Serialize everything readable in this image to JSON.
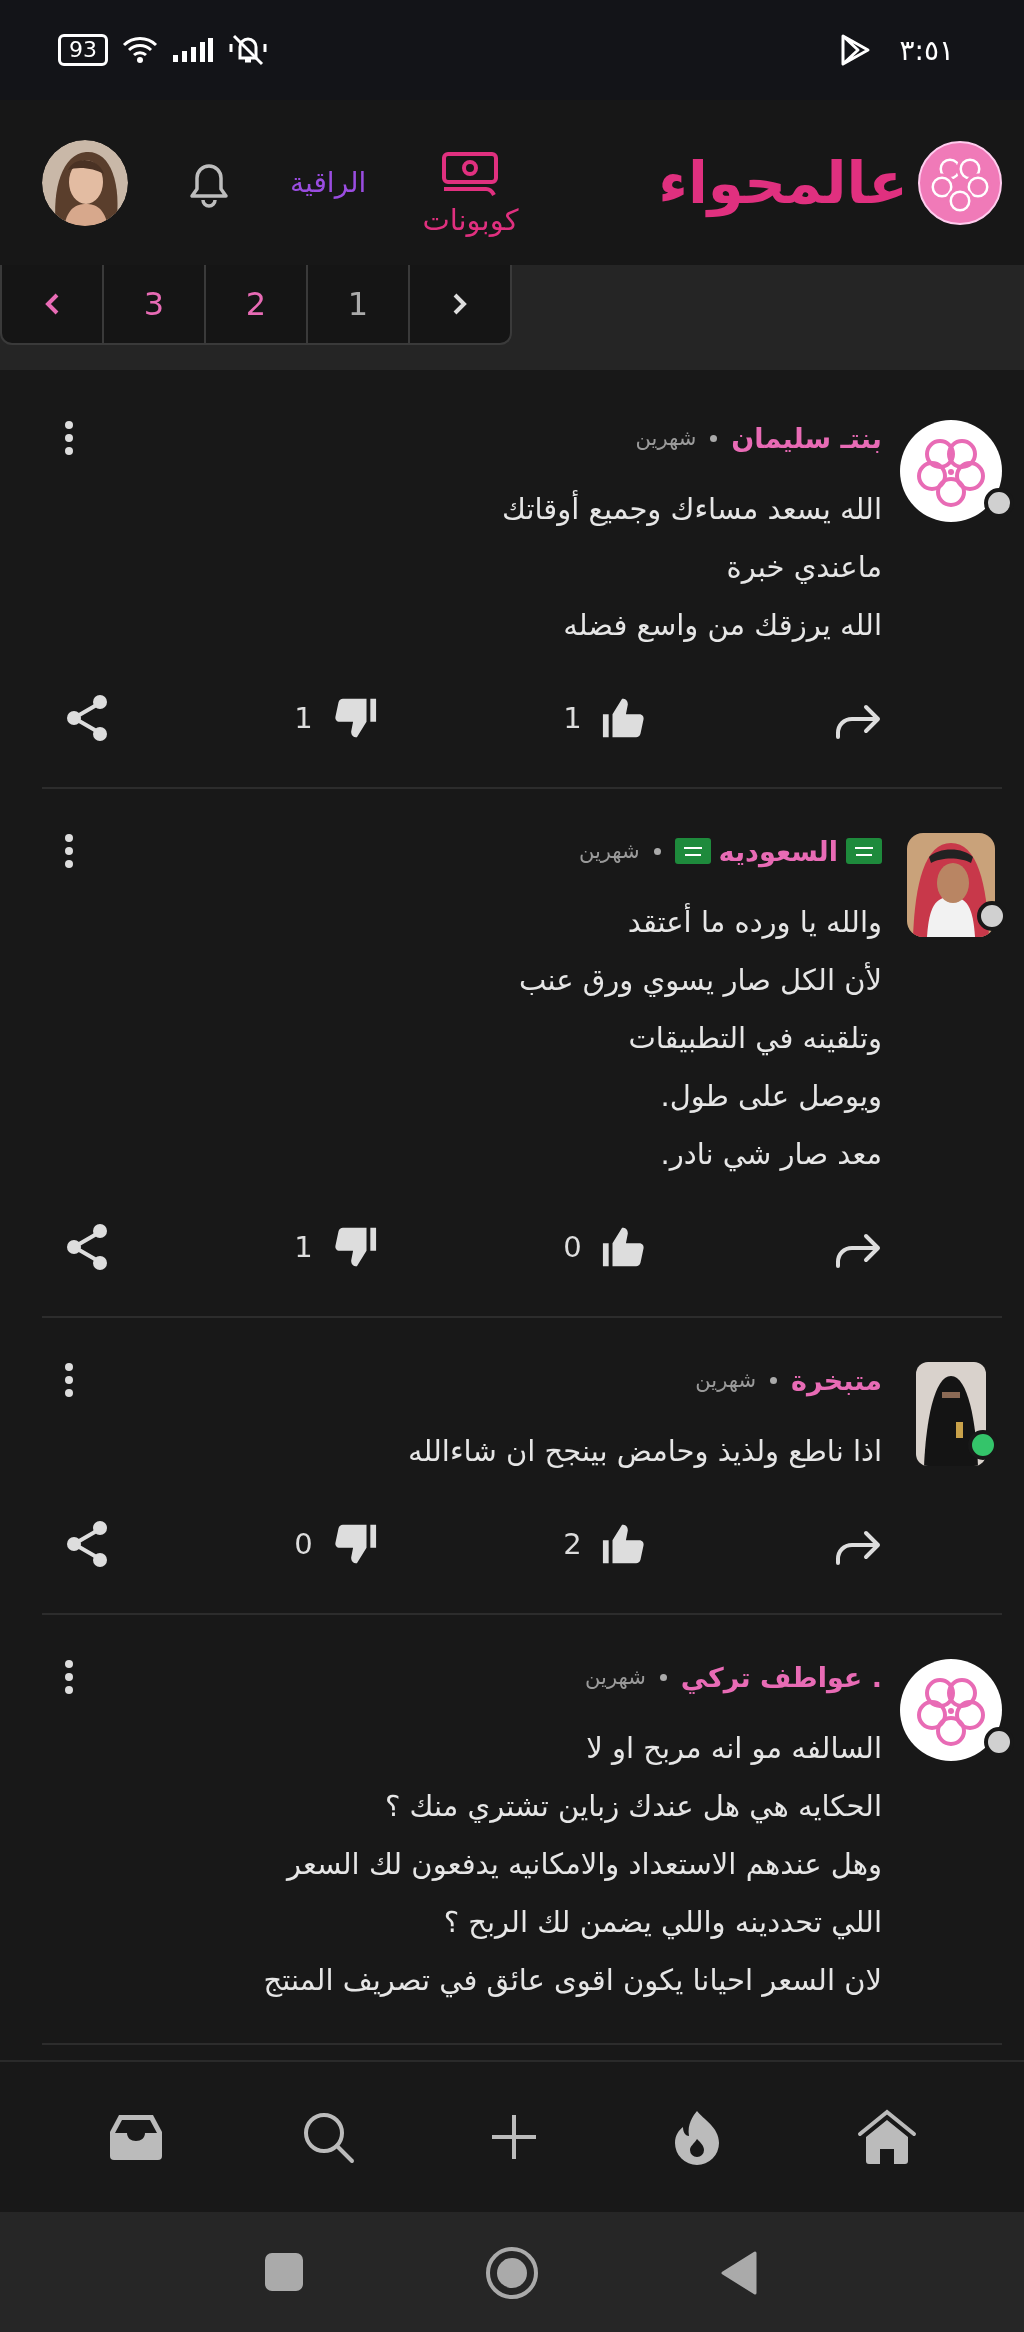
{
  "status_bar": {
    "time": "٣:٥١",
    "battery": "93"
  },
  "header": {
    "logo_text": "عالمحواء",
    "coupons_label": "كوبونات",
    "premium_label": "الراقية"
  },
  "pagination": [
    {
      "label": "1",
      "selected": true
    },
    {
      "label": "2",
      "selected": false
    },
    {
      "label": "3",
      "selected": false
    }
  ],
  "comments": [
    {
      "author": "بنتـ سليمان",
      "time": "شهرين",
      "avatar": {
        "kind": "logo"
      },
      "online": false,
      "flags": false,
      "lines": [
        "الله يسعد مساءك وجميع أوقاتك",
        "ماعندي خبرة",
        "الله يرزقك من واسع فضله"
      ],
      "likes": "1",
      "dislikes": "1"
    },
    {
      "author": "السعوديه",
      "time": "شهرين",
      "avatar": {
        "kind": "man"
      },
      "online": false,
      "flags": true,
      "lines": [
        "والله يا ورده ما أعتقد",
        "لأن الكل صار يسوي ورق عنب",
        "وتلقينه في التطبيقات",
        "ويوصل على طول.",
        "معد صار شي نادر."
      ],
      "likes": "0",
      "dislikes": "1"
    },
    {
      "author": "متبخرة",
      "time": "شهرين",
      "avatar": {
        "kind": "veiled"
      },
      "online": true,
      "flags": false,
      "lines": [
        "اذا ناطع ولذيذ وحامض بينجح ان شاءالله"
      ],
      "likes": "2",
      "dislikes": "0"
    },
    {
      "author": "عواطف تركي .",
      "time": "شهرين",
      "avatar": {
        "kind": "logo"
      },
      "online": false,
      "flags": false,
      "lines": [
        "السالفه مو انه مربح او لا",
        "الحكايه هي هل عندك زباين تشتري منك ؟",
        "وهل عندهم الاستعداد والامكانيه يدفعون لك السعر",
        "اللي تحددينه واللي يضمن لك الربح ؟",
        "لان السعر احيانا يكون اقوى عائق في تصريف المنتج"
      ]
    }
  ]
}
